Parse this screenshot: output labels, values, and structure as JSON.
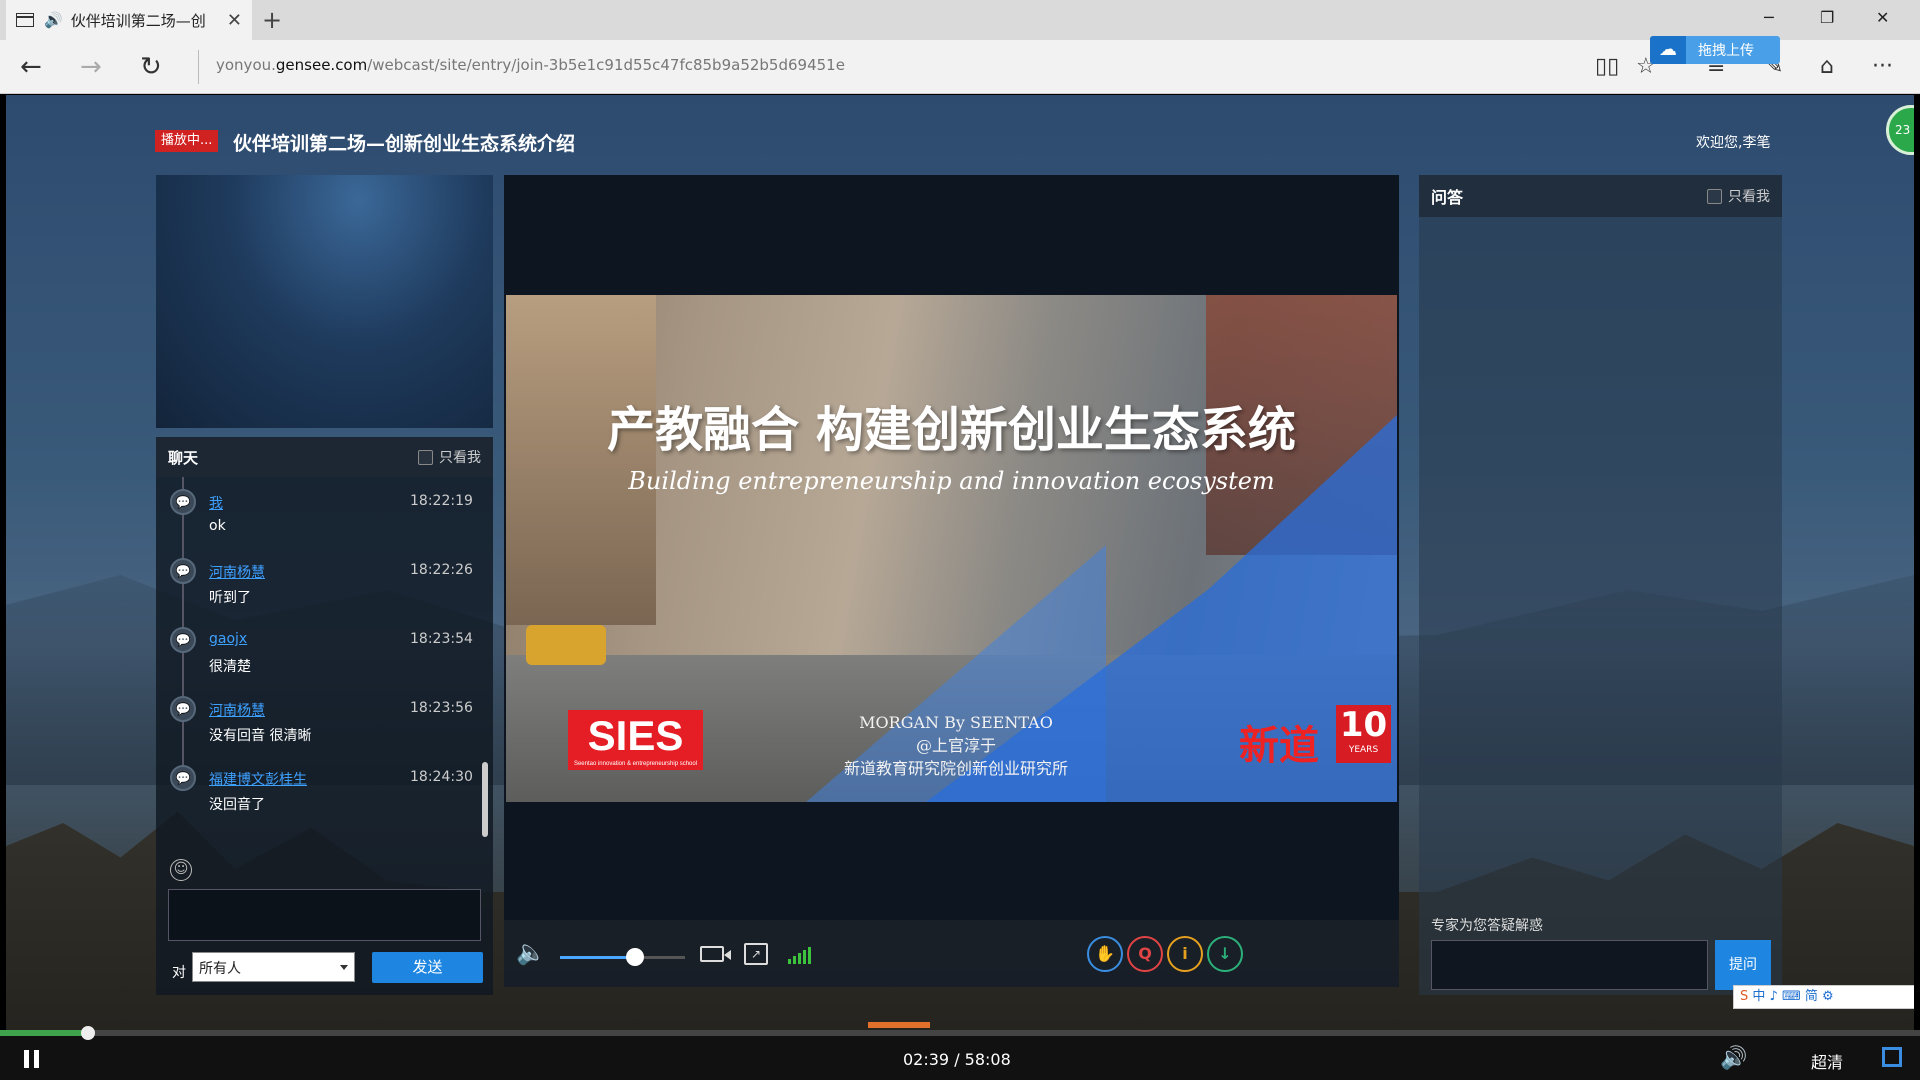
{
  "browser": {
    "tab_title": "伙伴培训第二场—创",
    "tab_audio": "🔊",
    "url_prefix": "yonyou.",
    "url_domain": "gensee.com",
    "url_path": "/webcast/site/entry/join-3b5e1c91d55c47fc85b9a52b5d69451e",
    "upload_label": "拖拽上传"
  },
  "header": {
    "live_badge": "播放中...",
    "title": "伙伴培训第二场—创新创业生态系统介绍",
    "welcome": "欢迎您,李笔",
    "float_badge": "23"
  },
  "chat": {
    "title": "聊天",
    "only_me": "只看我",
    "messages": [
      {
        "name": "我",
        "time": "18:22:19",
        "text": "ok"
      },
      {
        "name": "河南杨慧",
        "time": "18:22:26",
        "text": "听到了"
      },
      {
        "name": "gaojx",
        "time": "18:23:54",
        "text": "很清楚"
      },
      {
        "name": "河南杨慧",
        "time": "18:23:56",
        "text": "没有回音 很清晰"
      },
      {
        "name": "福建博文彭桂生",
        "time": "18:24:30",
        "text": "没回音了"
      }
    ],
    "to_label": "对",
    "to_value": "所有人",
    "send_label": "发送"
  },
  "slide": {
    "title": "产教融合 构建创新创业生态系统",
    "subtitle": "Building entrepreneurship  and innovation  ecosystem",
    "sies": "SIES",
    "sies_small": "Seentao innovation & entrepreneurship school",
    "credit_1": "MORGAN   By SEENTAO",
    "credit_2": "@上官淳于",
    "credit_3": "新道教育研究院创新创业研究所",
    "brand": "新道",
    "years": "10",
    "years_label": "YEARS"
  },
  "video_controls": {
    "volume": 0.6,
    "circle_icons": [
      "✋",
      "Q",
      "i",
      "↓"
    ]
  },
  "qa": {
    "title": "问答",
    "only_me": "只看我",
    "hint": "专家为您答疑解惑",
    "ask_label": "提问"
  },
  "ime": {
    "text": "中 ♪ ⌨ 简 ⚙"
  },
  "player": {
    "progress": 0.046,
    "timecode": "02:39 / 58:08",
    "quality": "超清"
  },
  "colors": {
    "accent": "#1e86e0",
    "live_red": "#d12222",
    "progress_green": "#3fa34d",
    "link_blue": "#3ea0ff"
  }
}
